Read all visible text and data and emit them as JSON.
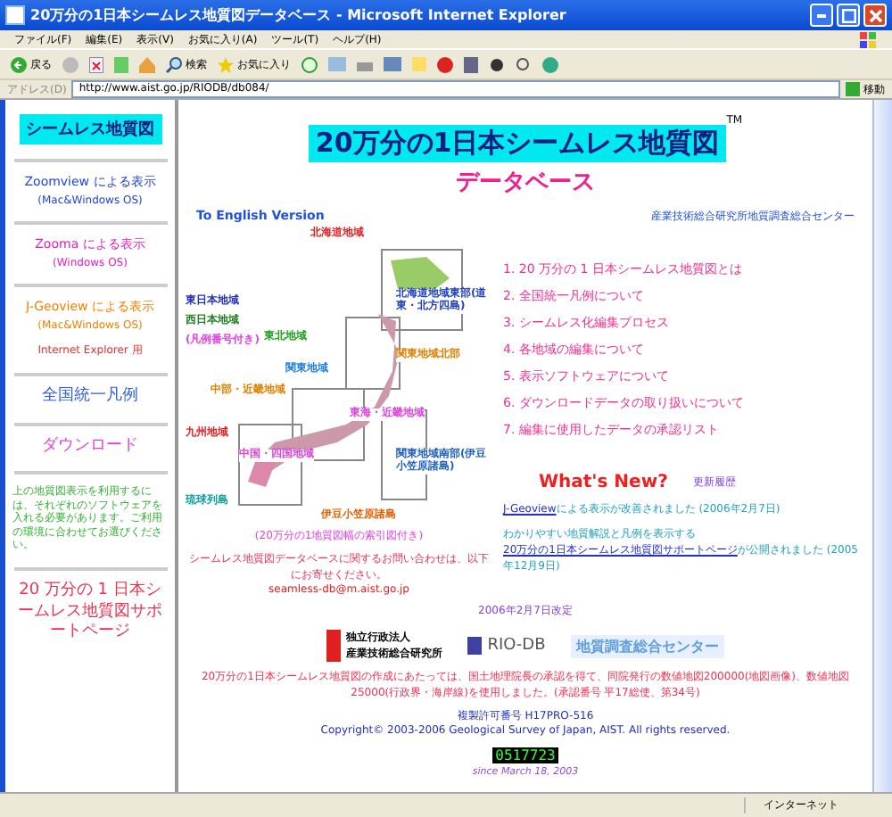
{
  "window": {
    "title": "20万分の1日本シームレス地質図データベース - Microsoft Internet Explorer"
  },
  "menu": [
    "ファイル(F)",
    "編集(E)",
    "表示(V)",
    "お気に入り(A)",
    "ツール(T)",
    "ヘルプ(H)"
  ],
  "toolbar": {
    "back": "戻る",
    "search": "検索",
    "favorites": "お気に入り"
  },
  "address": {
    "label": "アドレス(D)",
    "url": "http://www.aist.go.jp/RIODB/db084/",
    "go": "移動"
  },
  "sidebar": {
    "logo": "シームレス地質図",
    "items": [
      {
        "kind": "link",
        "title": "Zoomview による表示",
        "sub": "(Mac&Windows OS)",
        "color": "#2244dd"
      },
      {
        "kind": "link",
        "title": "Zooma による表示",
        "sub": "(Windows OS)",
        "color": "#e020c0"
      },
      {
        "kind": "link",
        "title": "J-Geoview による表示",
        "sub": "(Mac&Windows OS)",
        "note": "Internet Explorer 用",
        "color": "#f08000"
      },
      {
        "kind": "big",
        "title": "全国統一凡例",
        "color": "#3060e0"
      },
      {
        "kind": "big",
        "title": "ダウンロード",
        "color": "#e040e0"
      },
      {
        "kind": "text",
        "title": "上の地質図表示を利用するには、それぞれのソフトウェアを入れる必要があります。ご利用の環境に合わせてお選びください。",
        "color": "#30b030"
      },
      {
        "kind": "big",
        "title": "20 万分の 1 日本シームレス地質図サポートページ",
        "color": "#f03050"
      }
    ]
  },
  "header": {
    "logo": "20万分の1日本シームレス地質図",
    "tm": "TM",
    "subtitle": "データベース",
    "english": "To English Version",
    "org": "産業技術総合研究所地質調査総合センター"
  },
  "map": {
    "legend": [
      {
        "label": "東日本地域",
        "color": "#2030c0"
      },
      {
        "label": "西日本地域",
        "color": "#208020"
      },
      {
        "label": "(凡例番号付き)",
        "color": "#e040e0"
      }
    ],
    "labels": [
      {
        "text": "北海道地域",
        "color": "#e02020"
      },
      {
        "text": "北海道地域東部(道東・北方四島)",
        "color": "#2040c0"
      },
      {
        "text": "東北地域",
        "color": "#20a020"
      },
      {
        "text": "関東地域",
        "color": "#2080e0"
      },
      {
        "text": "中部・近畿地域",
        "color": "#e08000"
      },
      {
        "text": "関東地域北部",
        "color": "#e08000"
      },
      {
        "text": "九州地域",
        "color": "#e02020"
      },
      {
        "text": "中国・四国地域",
        "color": "#e040e0"
      },
      {
        "text": "東海・近畿地域",
        "color": "#e040e0"
      },
      {
        "text": "関東地域南部(伊豆小笠原諸島)",
        "color": "#2060c0"
      },
      {
        "text": "琉球列島",
        "color": "#10a0a0"
      },
      {
        "text": "伊豆小笠原諸島",
        "color": "#e06000"
      }
    ],
    "caption": "(20万分の1地質図幅の索引図付き)",
    "contact": "シームレス地質図データベースに関するお問い合わせは、以下にお寄せください。",
    "email": "seamless-db@m.aist.go.jp"
  },
  "links": [
    "1. 20 万分の 1 日本シームレス地質図とは",
    "2. 全国統一凡例について",
    "3. シームレス化編集プロセス",
    "4. 各地域の編集について",
    "5. 表示ソフトウェアについて",
    "6. ダウンロードデータの取り扱いについて",
    "7. 編集に使用したデータの承認リスト"
  ],
  "news": {
    "title": "What's New?",
    "history": "更新履歴",
    "items": [
      {
        "link": "J-Geoview",
        "text": "による表示が改善されました (2006年2月7日)"
      },
      {
        "pre": "わかりやすい地質解説と凡例を表示する",
        "link": "20万分の1日本シームレス地質図サポートページ",
        "text": "が公開されました (2005年12月9日)"
      }
    ]
  },
  "footer": {
    "date": "2006年2月7日改定",
    "logos": [
      "独立行政法人",
      "産業技術総合研究所",
      "RIO-DB",
      "地質調査総合センター"
    ],
    "notice": "20万分の1日本シームレス地質図の作成にあたっては、国土地理院長の承認を得て、同院発行の数値地図200000(地図画像)、数値地図25000(行政界・海岸線)を使用しました。(承認番号 平17総使、第34号)",
    "permit": "複製許可番号 H17PRO-516",
    "copyright": "Copyright© 2003-2006 Geological Survey of Japan, AIST. All rights reserved.",
    "counter": "0517723",
    "since": "since March 18, 2003"
  },
  "status": {
    "zone": "インターネット"
  }
}
